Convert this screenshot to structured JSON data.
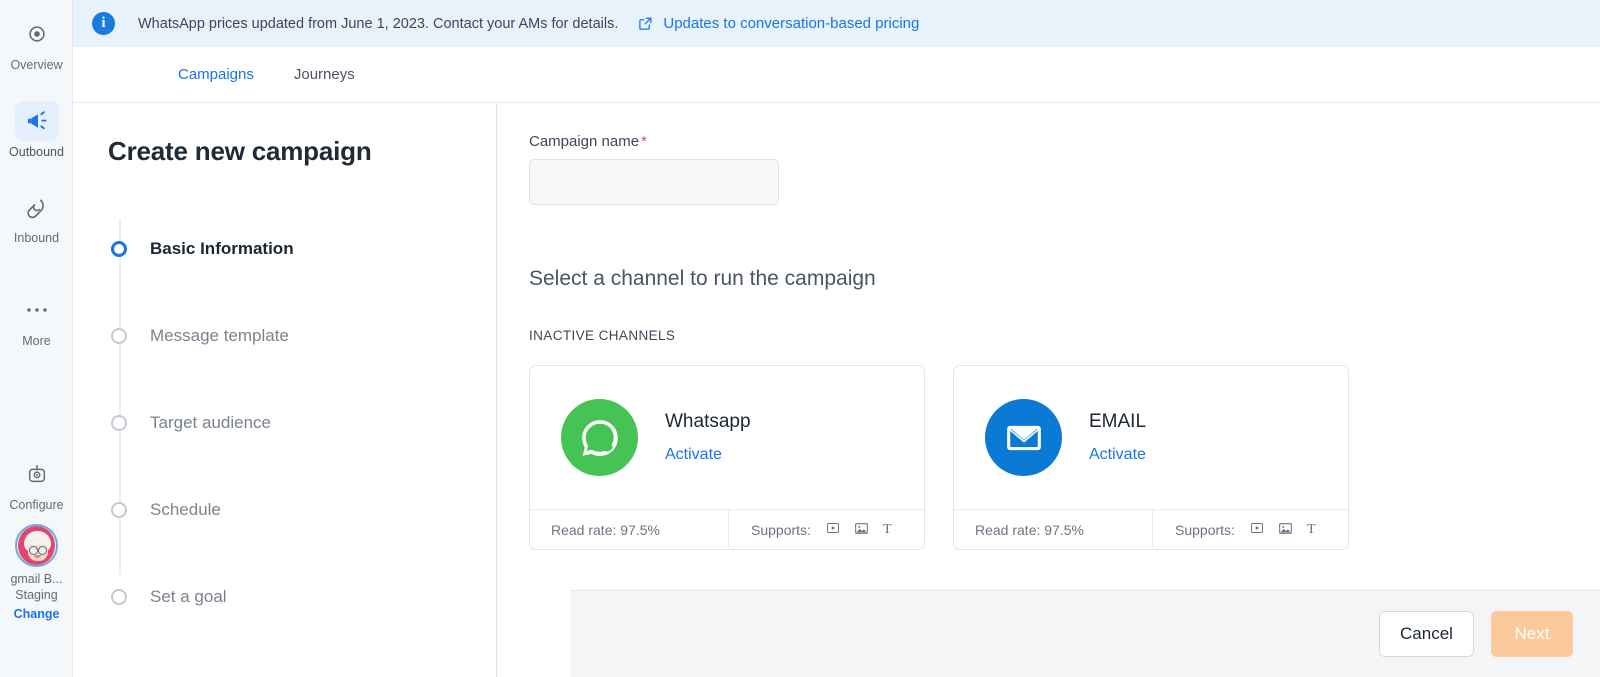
{
  "rail": {
    "items": [
      {
        "label": "Overview",
        "icon": "eye-icon",
        "active": false
      },
      {
        "label": "Outbound",
        "icon": "megaphone-icon",
        "active": true
      },
      {
        "label": "Inbound",
        "icon": "magnet-icon",
        "active": false
      },
      {
        "label": "More",
        "icon": "ellipsis-icon",
        "active": false
      },
      {
        "label": "Configure",
        "icon": "robot-icon",
        "active": false
      }
    ],
    "user": {
      "name": "gmail B...",
      "environment": "Staging",
      "change_label": "Change",
      "avatar": "user-avatar"
    }
  },
  "banner": {
    "icon": "info-icon",
    "text": "WhatsApp prices updated from June 1, 2023. Contact your AMs for details.",
    "link_icon": "external-link-icon",
    "link_label": "Updates to conversation-based pricing",
    "background": "#e8f2fb",
    "link_color": "#1a73e8"
  },
  "tabs": [
    {
      "label": "Campaigns",
      "active": true
    },
    {
      "label": "Journeys",
      "active": false
    }
  ],
  "wizard": {
    "title": "Create new campaign",
    "steps": [
      {
        "label": "Basic Information",
        "active": true
      },
      {
        "label": "Message template",
        "active": false
      },
      {
        "label": "Target audience",
        "active": false
      },
      {
        "label": "Schedule",
        "active": false
      },
      {
        "label": "Set a goal",
        "active": false
      }
    ]
  },
  "form": {
    "campaign_name_label": "Campaign name",
    "required_marker": "*",
    "campaign_name_value": "",
    "campaign_name_placeholder": "",
    "channel_section_title": "Select a channel to run the campaign",
    "channel_group_title": "INACTIVE CHANNELS",
    "channels": [
      {
        "name": "Whatsapp",
        "action_label": "Activate",
        "logo": "whatsapp-logo",
        "logo_color": "#45c354",
        "read_rate_label": "Read rate: 97.5%",
        "supports_label": "Supports:",
        "supports": [
          "video-icon",
          "image-icon",
          "text-icon"
        ]
      },
      {
        "name": "EMAIL",
        "action_label": "Activate",
        "logo": "email-logo",
        "logo_color": "#0a7ad4",
        "read_rate_label": "Read rate: 97.5%",
        "supports_label": "Supports:",
        "supports": [
          "video-icon",
          "image-icon",
          "text-icon"
        ]
      }
    ]
  },
  "footer": {
    "cancel_label": "Cancel",
    "next_label": "Next",
    "next_disabled_color": "#fac99c"
  }
}
